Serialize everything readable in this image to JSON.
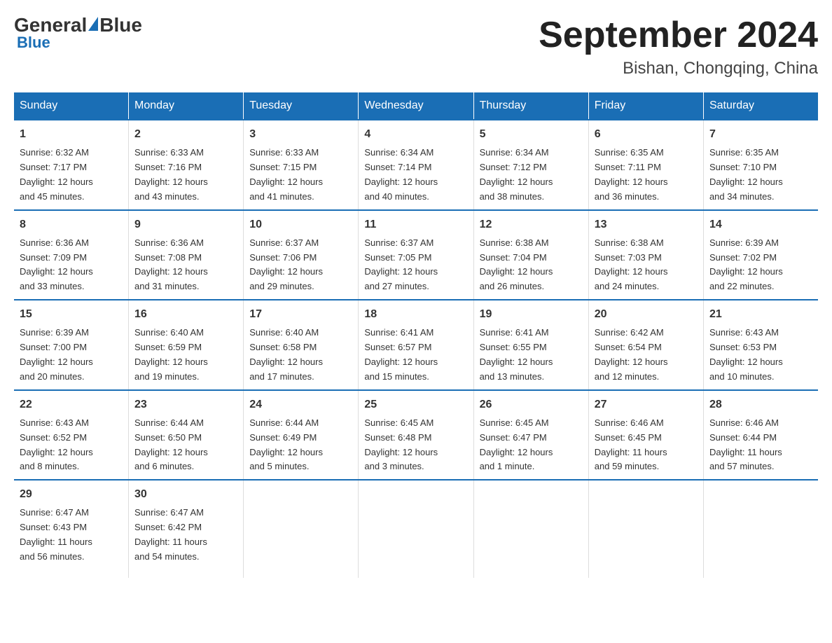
{
  "header": {
    "logo_general": "General",
    "logo_blue": "Blue",
    "title": "September 2024",
    "subtitle": "Bishan, Chongqing, China"
  },
  "days_of_week": [
    "Sunday",
    "Monday",
    "Tuesday",
    "Wednesday",
    "Thursday",
    "Friday",
    "Saturday"
  ],
  "weeks": [
    [
      {
        "day": "1",
        "sunrise": "6:32 AM",
        "sunset": "7:17 PM",
        "daylight": "12 hours and 45 minutes."
      },
      {
        "day": "2",
        "sunrise": "6:33 AM",
        "sunset": "7:16 PM",
        "daylight": "12 hours and 43 minutes."
      },
      {
        "day": "3",
        "sunrise": "6:33 AM",
        "sunset": "7:15 PM",
        "daylight": "12 hours and 41 minutes."
      },
      {
        "day": "4",
        "sunrise": "6:34 AM",
        "sunset": "7:14 PM",
        "daylight": "12 hours and 40 minutes."
      },
      {
        "day": "5",
        "sunrise": "6:34 AM",
        "sunset": "7:12 PM",
        "daylight": "12 hours and 38 minutes."
      },
      {
        "day": "6",
        "sunrise": "6:35 AM",
        "sunset": "7:11 PM",
        "daylight": "12 hours and 36 minutes."
      },
      {
        "day": "7",
        "sunrise": "6:35 AM",
        "sunset": "7:10 PM",
        "daylight": "12 hours and 34 minutes."
      }
    ],
    [
      {
        "day": "8",
        "sunrise": "6:36 AM",
        "sunset": "7:09 PM",
        "daylight": "12 hours and 33 minutes."
      },
      {
        "day": "9",
        "sunrise": "6:36 AM",
        "sunset": "7:08 PM",
        "daylight": "12 hours and 31 minutes."
      },
      {
        "day": "10",
        "sunrise": "6:37 AM",
        "sunset": "7:06 PM",
        "daylight": "12 hours and 29 minutes."
      },
      {
        "day": "11",
        "sunrise": "6:37 AM",
        "sunset": "7:05 PM",
        "daylight": "12 hours and 27 minutes."
      },
      {
        "day": "12",
        "sunrise": "6:38 AM",
        "sunset": "7:04 PM",
        "daylight": "12 hours and 26 minutes."
      },
      {
        "day": "13",
        "sunrise": "6:38 AM",
        "sunset": "7:03 PM",
        "daylight": "12 hours and 24 minutes."
      },
      {
        "day": "14",
        "sunrise": "6:39 AM",
        "sunset": "7:02 PM",
        "daylight": "12 hours and 22 minutes."
      }
    ],
    [
      {
        "day": "15",
        "sunrise": "6:39 AM",
        "sunset": "7:00 PM",
        "daylight": "12 hours and 20 minutes."
      },
      {
        "day": "16",
        "sunrise": "6:40 AM",
        "sunset": "6:59 PM",
        "daylight": "12 hours and 19 minutes."
      },
      {
        "day": "17",
        "sunrise": "6:40 AM",
        "sunset": "6:58 PM",
        "daylight": "12 hours and 17 minutes."
      },
      {
        "day": "18",
        "sunrise": "6:41 AM",
        "sunset": "6:57 PM",
        "daylight": "12 hours and 15 minutes."
      },
      {
        "day": "19",
        "sunrise": "6:41 AM",
        "sunset": "6:55 PM",
        "daylight": "12 hours and 13 minutes."
      },
      {
        "day": "20",
        "sunrise": "6:42 AM",
        "sunset": "6:54 PM",
        "daylight": "12 hours and 12 minutes."
      },
      {
        "day": "21",
        "sunrise": "6:43 AM",
        "sunset": "6:53 PM",
        "daylight": "12 hours and 10 minutes."
      }
    ],
    [
      {
        "day": "22",
        "sunrise": "6:43 AM",
        "sunset": "6:52 PM",
        "daylight": "12 hours and 8 minutes."
      },
      {
        "day": "23",
        "sunrise": "6:44 AM",
        "sunset": "6:50 PM",
        "daylight": "12 hours and 6 minutes."
      },
      {
        "day": "24",
        "sunrise": "6:44 AM",
        "sunset": "6:49 PM",
        "daylight": "12 hours and 5 minutes."
      },
      {
        "day": "25",
        "sunrise": "6:45 AM",
        "sunset": "6:48 PM",
        "daylight": "12 hours and 3 minutes."
      },
      {
        "day": "26",
        "sunrise": "6:45 AM",
        "sunset": "6:47 PM",
        "daylight": "12 hours and 1 minute."
      },
      {
        "day": "27",
        "sunrise": "6:46 AM",
        "sunset": "6:45 PM",
        "daylight": "11 hours and 59 minutes."
      },
      {
        "day": "28",
        "sunrise": "6:46 AM",
        "sunset": "6:44 PM",
        "daylight": "11 hours and 57 minutes."
      }
    ],
    [
      {
        "day": "29",
        "sunrise": "6:47 AM",
        "sunset": "6:43 PM",
        "daylight": "11 hours and 56 minutes."
      },
      {
        "day": "30",
        "sunrise": "6:47 AM",
        "sunset": "6:42 PM",
        "daylight": "11 hours and 54 minutes."
      },
      null,
      null,
      null,
      null,
      null
    ]
  ],
  "labels": {
    "sunrise": "Sunrise:",
    "sunset": "Sunset:",
    "daylight": "Daylight:"
  }
}
